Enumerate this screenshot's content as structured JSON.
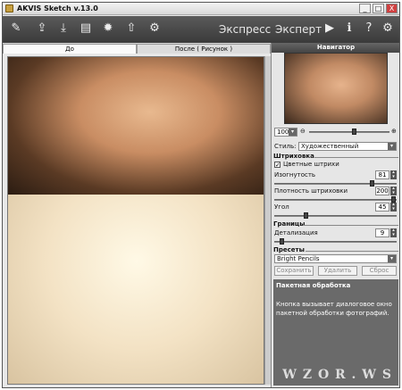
{
  "app": {
    "title": "AKVIS Sketch v.13.0"
  },
  "window_buttons": {
    "minimize": "_",
    "maximize": "□",
    "close": "X"
  },
  "toolbar": {
    "mode_express": "Экспресс",
    "mode_expert": "Эксперт",
    "icons": [
      "brush-icon",
      "open-icon",
      "save-icon",
      "print-icon",
      "settings-icon",
      "share-icon",
      "batch-icon",
      "run-icon",
      "info-icon",
      "help-icon",
      "gear-icon"
    ]
  },
  "tabs": {
    "before": "До",
    "after": "После ( Рисунок )"
  },
  "navigator": {
    "header": "Навигатор",
    "zoom": "100%"
  },
  "style": {
    "label": "Стиль:",
    "value": "Художественный"
  },
  "hatching": {
    "section": "Штриховка",
    "color_strokes": "Цветные штрихи",
    "color_strokes_checked": "✓",
    "curvature_label": "Изогнутость",
    "curvature_value": "81",
    "density_label": "Плотность штриховки",
    "density_value": "200",
    "angle_label": "Угол",
    "angle_value": "45"
  },
  "edges": {
    "section": "Границы",
    "detail_label": "Детализация",
    "detail_value": "9"
  },
  "presets": {
    "section": "Пресеты",
    "value": "Bright Pencils",
    "save": "Сохранить",
    "delete": "Удалить",
    "reset": "Сброс"
  },
  "help": {
    "title": "Пакетная обработка",
    "text": "Кнопка вызывает диалоговое окно пакетной обработки фотографий."
  },
  "watermark": "W Z O R . W S"
}
